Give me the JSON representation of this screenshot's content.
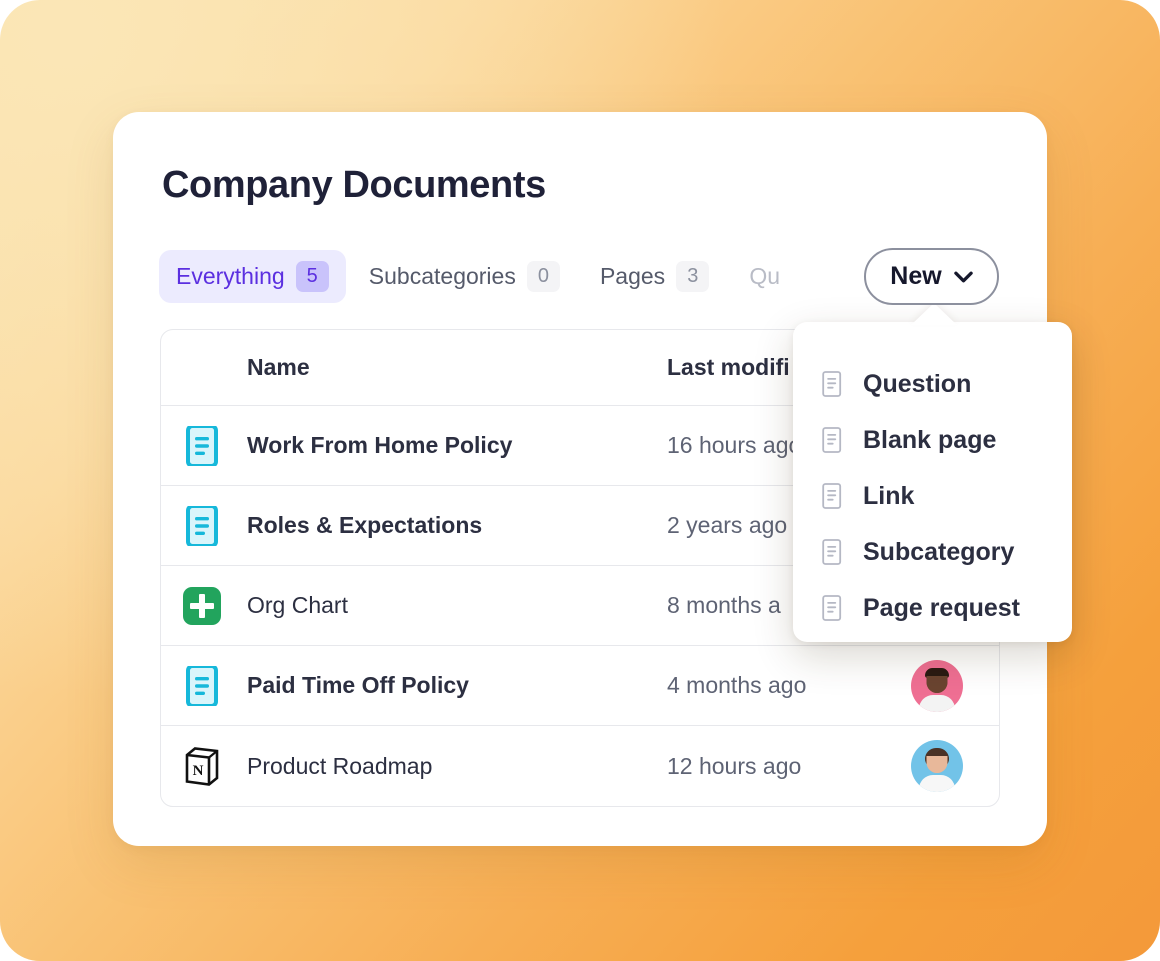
{
  "theme": {
    "bg_gradient_from": "#FAE3B0",
    "bg_gradient_to": "#F5A03C",
    "card_bg": "#FFFFFF",
    "accent_purple": "#5B2FE0",
    "accent_purple_bg": "#ECEBFE",
    "badge_bg": "#F4F4F6",
    "doc_icon_cyan": "#16B8DA",
    "sheets_icon_green": "#22A45D",
    "title_color": "#1F2138",
    "muted_text": "#5E6374"
  },
  "header": {
    "title": "Company Documents"
  },
  "tabs": [
    {
      "label": "Everything",
      "badge": "5",
      "active": true,
      "clipped": false
    },
    {
      "label": "Subcategories",
      "badge": "0",
      "active": false,
      "clipped": false
    },
    {
      "label": "Pages",
      "badge": "3",
      "active": false,
      "clipped": false
    },
    {
      "label": "Qu",
      "badge": "",
      "active": false,
      "clipped": true
    }
  ],
  "toolbar": {
    "new_label": "New",
    "chevron_icon": "chevron-down-icon"
  },
  "table": {
    "columns": [
      "Name",
      "Last modifi"
    ],
    "rows": [
      {
        "icon": "document-icon-cyan",
        "name": "Work From Home Policy",
        "weight": "bold",
        "modified": "16 hours ago",
        "avatar": ""
      },
      {
        "icon": "document-icon-cyan",
        "name": "Roles & Expectations",
        "weight": "bold",
        "modified": "2 years ago",
        "avatar": ""
      },
      {
        "icon": "google-sheets-icon",
        "name": "Org Chart",
        "weight": "med",
        "modified": "8 months a",
        "avatar": ""
      },
      {
        "icon": "document-icon-cyan",
        "name": "Paid Time Off Policy",
        "weight": "bold",
        "modified": "4 months ago",
        "avatar": "avatar-pink"
      },
      {
        "icon": "notion-icon",
        "name": "Product Roadmap",
        "weight": "med",
        "modified": "12 hours ago",
        "avatar": "avatar-blue"
      }
    ]
  },
  "dropdown": {
    "items": [
      {
        "label": "Question",
        "icon": "document-icon-gray"
      },
      {
        "label": "Blank page",
        "icon": "document-icon-gray"
      },
      {
        "label": "Link",
        "icon": "document-icon-gray"
      },
      {
        "label": "Subcategory",
        "icon": "document-icon-gray"
      },
      {
        "label": "Page request",
        "icon": "document-icon-gray"
      }
    ]
  }
}
